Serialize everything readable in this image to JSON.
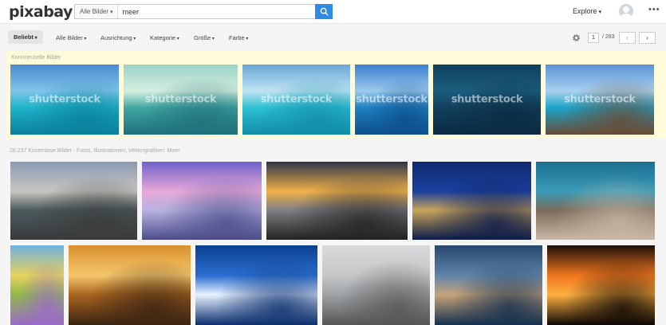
{
  "header": {
    "logo": "pixabay",
    "search_category": "Alle Bilder",
    "search_query": "meer",
    "explore_label": "Explore",
    "more_label": "•••"
  },
  "filters": {
    "sort": "Beliebt",
    "items": [
      "Alle Bilder",
      "Ausrichtung",
      "Kategorie",
      "Größe",
      "Farbe"
    ]
  },
  "pagination": {
    "current": "1",
    "total": "/ 283",
    "prev": "‹",
    "next": "›"
  },
  "sections": {
    "commercial_label": "Kommerzielle Bilder",
    "free_label": "28.237 Kostenlose Bilder - Fotos, Illustrationen, Vektorgrafiken: Meer"
  },
  "watermark": "shutterstock",
  "sponsored_images": [
    {
      "name": "tropical-sea-waves",
      "colors": [
        "#4a8cd1",
        "#7fc4e8",
        "#1eb3c9",
        "#0a7f9a"
      ]
    },
    {
      "name": "lighthouse-illustration",
      "colors": [
        "#9ad3c7",
        "#d6eee0",
        "#3fa7a0",
        "#1f6f7a"
      ]
    },
    {
      "name": "turquoise-ocean-horizon",
      "colors": [
        "#6aa6d6",
        "#bfe3f2",
        "#2bc0d3",
        "#118ca8"
      ]
    },
    {
      "name": "calm-ocean-horizon",
      "colors": [
        "#3b7fcf",
        "#9cc9ec",
        "#1e7fc0",
        "#0d4f8b"
      ]
    },
    {
      "name": "aerial-deep-blue-sea",
      "colors": [
        "#0f3e5e",
        "#1b5e7e",
        "#123f5c",
        "#0a2b42"
      ]
    },
    {
      "name": "coastal-rocks",
      "colors": [
        "#5a93d6",
        "#a9d1ef",
        "#1aa3c8",
        "#6a4a35"
      ]
    }
  ],
  "free_images": [
    {
      "name": "amalfi-coast",
      "colors": [
        "#8a9ab2",
        "#c9c6c0",
        "#4a5b5e",
        "#3a3a3a"
      ]
    },
    {
      "name": "person-pink-sunset-beach",
      "colors": [
        "#6f63c9",
        "#e8a8d8",
        "#b7b2e0",
        "#4b4c8a"
      ]
    },
    {
      "name": "rocky-shore-sunset-waves",
      "colors": [
        "#2e3447",
        "#f0b14a",
        "#7f7f84",
        "#222222"
      ]
    },
    {
      "name": "jellyfish-blue",
      "colors": [
        "#0f2a6e",
        "#1a3f9e",
        "#c9a35a",
        "#0b1b4a"
      ]
    },
    {
      "name": "diver-on-rocks",
      "colors": [
        "#1b6f8f",
        "#3a9bb8",
        "#7a6b5a",
        "#c9b8a5"
      ]
    },
    {
      "name": "sea-urchins-stack",
      "colors": [
        "#6fb0e0",
        "#e7d25a",
        "#8fb84a",
        "#9a6ac9"
      ]
    },
    {
      "name": "sailing-ship-golden-sea",
      "colors": [
        "#d9902f",
        "#f4c66b",
        "#a9641f",
        "#3a2412"
      ]
    },
    {
      "name": "blue-wave-foam",
      "colors": [
        "#0a3f8f",
        "#2a6ed0",
        "#e8f2ff",
        "#0c2f6e"
      ]
    },
    {
      "name": "two-people-foggy-beach",
      "colors": [
        "#d8dadb",
        "#c4c6c8",
        "#9ea2a5",
        "#555555"
      ]
    },
    {
      "name": "breaking-wave-dusk",
      "colors": [
        "#27486e",
        "#5f84a8",
        "#c7a37a",
        "#15304f"
      ]
    },
    {
      "name": "orange-sunset-sea",
      "colors": [
        "#1a0f0a",
        "#f0761e",
        "#ffb040",
        "#0d0806"
      ]
    }
  ]
}
